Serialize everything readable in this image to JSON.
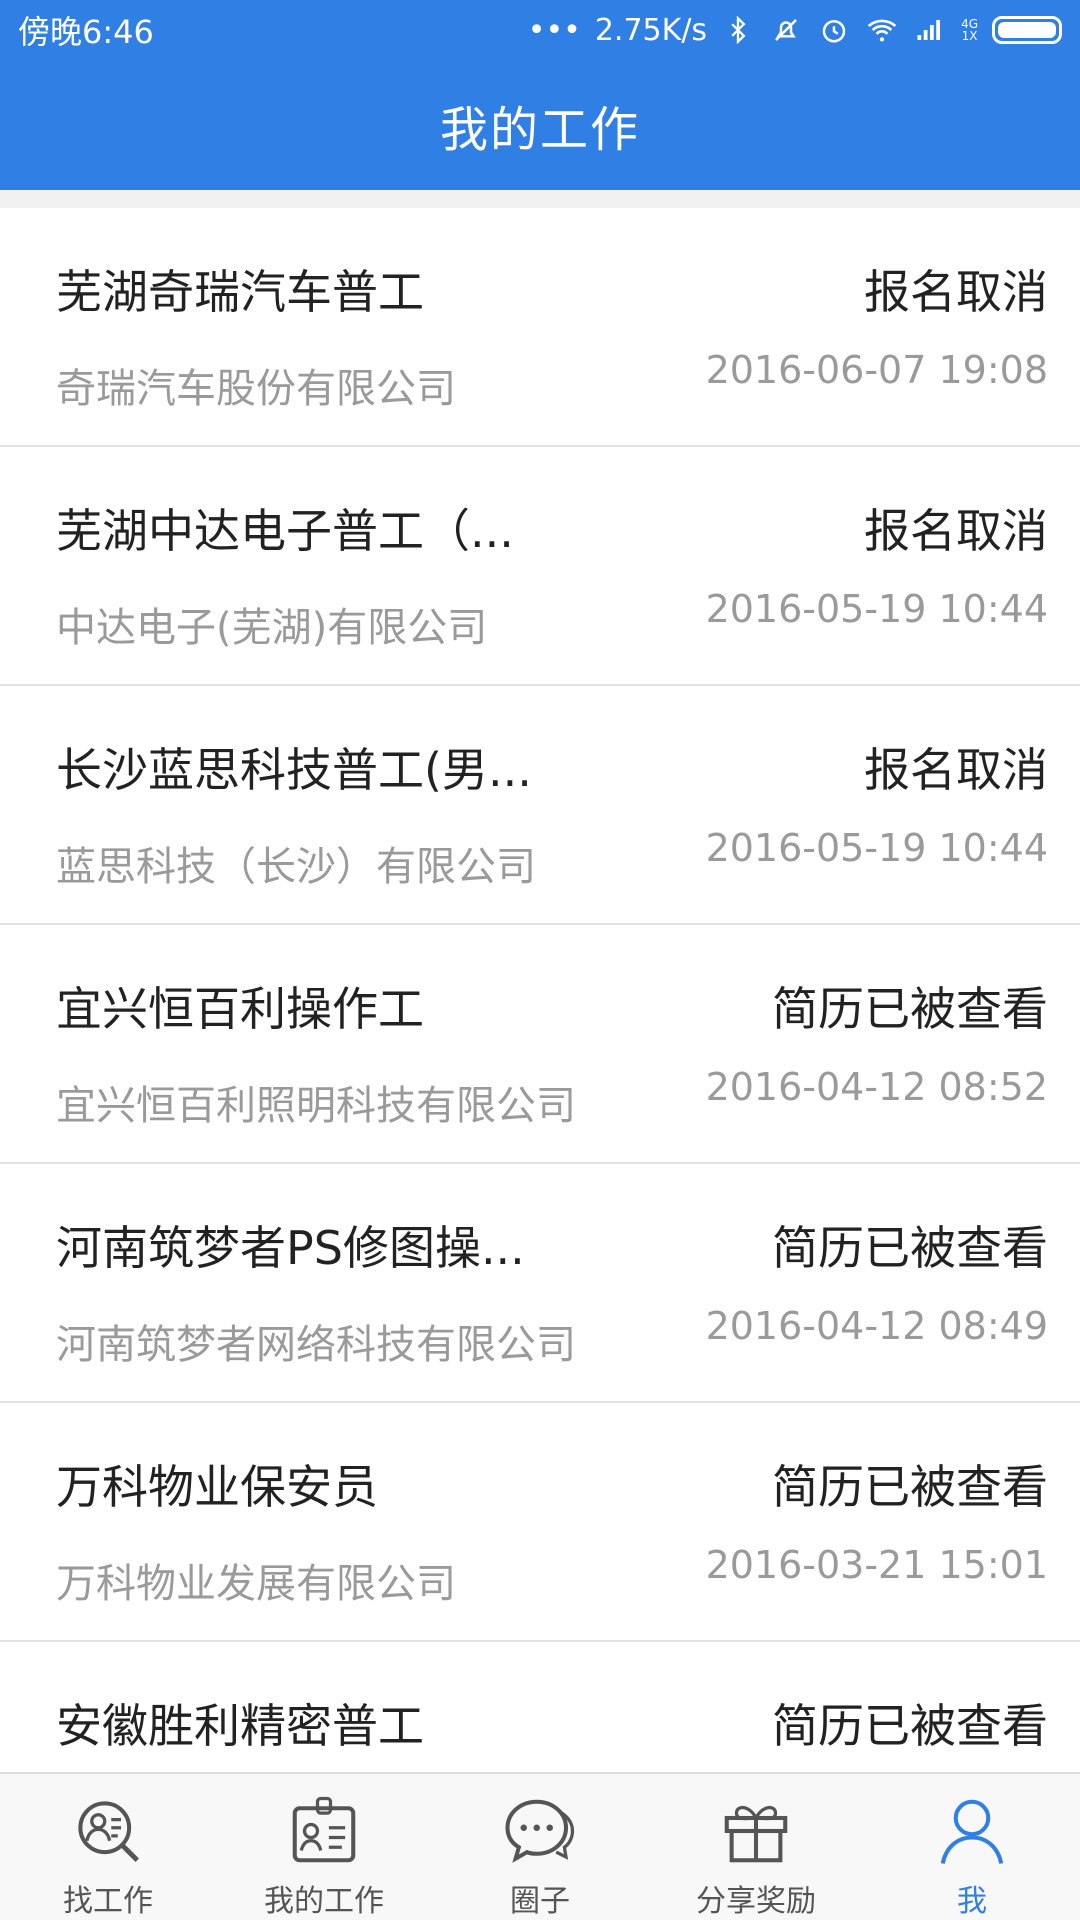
{
  "status_bar": {
    "time": "傍晚6:46",
    "dots": "•••",
    "network_speed": "2.75K/s",
    "signal_top": "4G",
    "signal_bottom": "1X"
  },
  "header": {
    "title": "我的工作"
  },
  "jobs": [
    {
      "title": "芜湖奇瑞汽车普工",
      "company": "奇瑞汽车股份有限公司",
      "status": "报名取消",
      "date": "2016-06-07 19:08"
    },
    {
      "title": "芜湖中达电子普工（...",
      "company": "中达电子(芜湖)有限公司",
      "status": "报名取消",
      "date": "2016-05-19 10:44"
    },
    {
      "title": "长沙蓝思科技普工(男...",
      "company": "蓝思科技（长沙）有限公司",
      "status": "报名取消",
      "date": "2016-05-19 10:44"
    },
    {
      "title": "宜兴恒百利操作工",
      "company": "宜兴恒百利照明科技有限公司",
      "status": "简历已被查看",
      "date": "2016-04-12 08:52"
    },
    {
      "title": "河南筑梦者PS修图操...",
      "company": "河南筑梦者网络科技有限公司",
      "status": "简历已被查看",
      "date": "2016-04-12 08:49"
    },
    {
      "title": "万科物业保安员",
      "company": "万科物业发展有限公司",
      "status": "简历已被查看",
      "date": "2016-03-21 15:01"
    },
    {
      "title": "安徽胜利精密普工",
      "company": "",
      "status": "简历已被查看",
      "date": ""
    }
  ],
  "bottom_nav": [
    {
      "label": "找工作",
      "icon": "find-job-icon"
    },
    {
      "label": "我的工作",
      "icon": "my-job-badge-icon"
    },
    {
      "label": "圈子",
      "icon": "chat-bubble-icon"
    },
    {
      "label": "分享奖励",
      "icon": "gift-icon"
    },
    {
      "label": "我",
      "icon": "person-icon"
    }
  ],
  "colors": {
    "primary": "#2f7fe4",
    "secondary_text": "#9a9a9a"
  }
}
